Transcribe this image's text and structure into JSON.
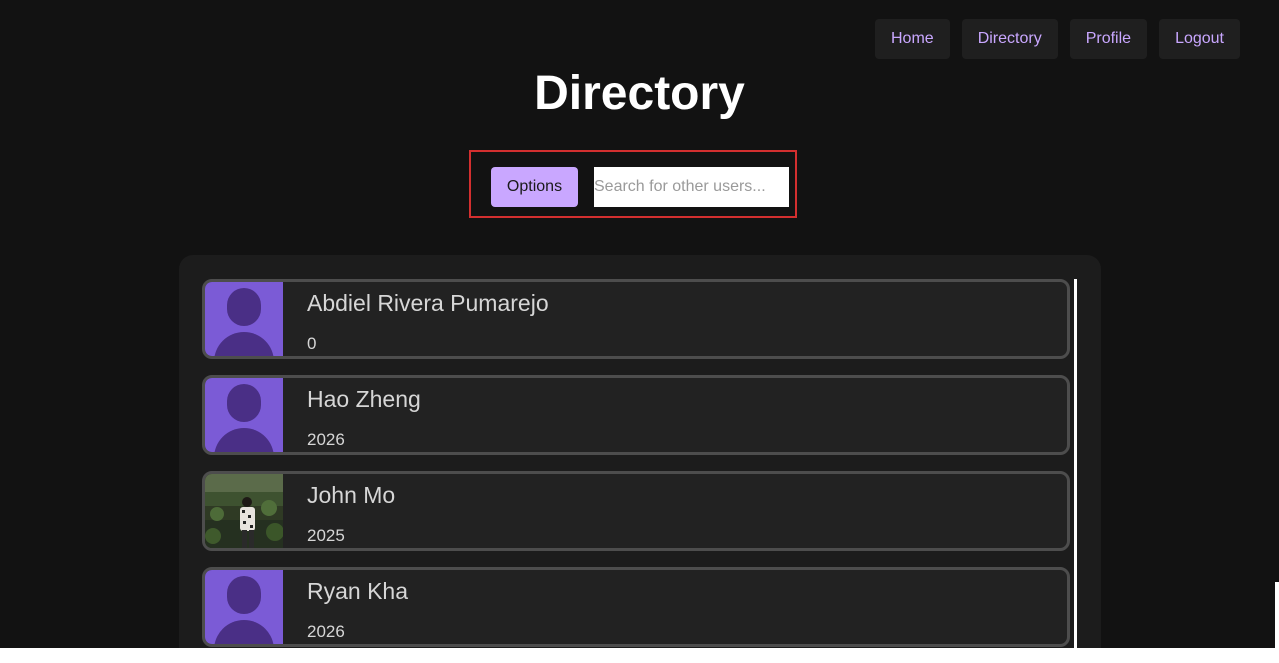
{
  "nav": {
    "items": [
      "Home",
      "Directory",
      "Profile",
      "Logout"
    ]
  },
  "title": "Directory",
  "search": {
    "options_label": "Options",
    "placeholder": "Search for other users..."
  },
  "users": [
    {
      "name": "Abdiel Rivera Pumarejo",
      "year": "0",
      "avatar": "default-avatar-icon"
    },
    {
      "name": "Hao Zheng",
      "year": "2026",
      "avatar": "default-avatar-icon"
    },
    {
      "name": "John Mo",
      "year": "2025",
      "avatar": "profile-photo"
    },
    {
      "name": "Ryan Kha",
      "year": "2026",
      "avatar": "default-avatar-icon"
    }
  ],
  "colors": {
    "background": "#121212",
    "accent": "#c9a7ff",
    "avatar_bg": "#7b5bd6",
    "avatar_fg": "#4a2f86",
    "highlight_border": "#d32f2f"
  }
}
